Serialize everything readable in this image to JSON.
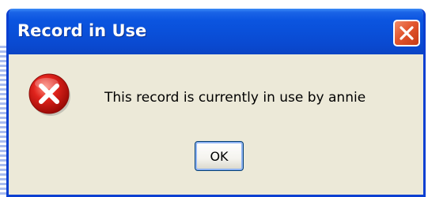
{
  "dialog": {
    "title": "Record in Use",
    "message": "This record is currently in use by annie",
    "ok_label": "OK",
    "icon": "error-icon",
    "close_icon": "close-icon"
  },
  "colors": {
    "titlebar": "#0a4fd8",
    "body": "#ece9d8",
    "close_button": "#e2552e",
    "error_icon": "#d40f0f"
  }
}
